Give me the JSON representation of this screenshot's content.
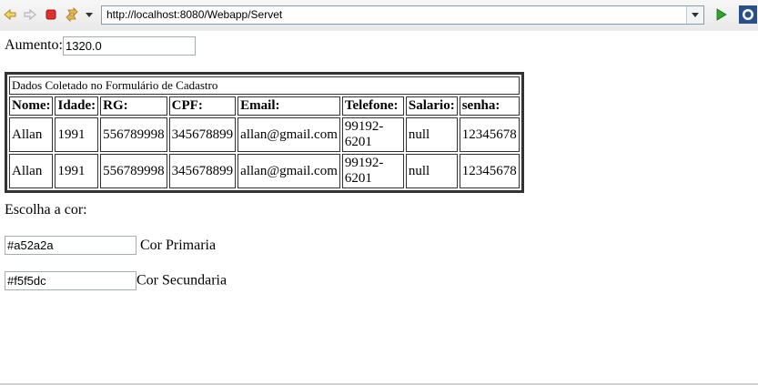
{
  "toolbar": {
    "back_icon": "back-arrow-icon",
    "forward_icon": "forward-arrow-icon",
    "stop_icon": "stop-icon",
    "refresh_icon": "refresh-icon",
    "url": "http://localhost:8080/Webapp/Servet",
    "go_icon": "go-play-icon",
    "eclipse_icon": "browser-app-icon"
  },
  "aumento": {
    "label": "Aumento:",
    "value": "1320.0"
  },
  "table": {
    "caption": "Dados Coletado no Formulário de Cadastro",
    "headers": [
      "Nome:",
      "Idade:",
      "RG:",
      "CPF:",
      "Email:",
      "Telefone:",
      "Salario:",
      "senha:"
    ],
    "rows": [
      [
        "Allan",
        "1991",
        "556789998",
        "345678899",
        "allan@gmail.com",
        "99192-6201",
        "null",
        "12345678"
      ],
      [
        "Allan",
        "1991",
        "556789998",
        "345678899",
        "allan@gmail.com",
        "99192-6201",
        "null",
        "12345678"
      ]
    ]
  },
  "cores": {
    "title": "Escolha a cor:",
    "primaria": {
      "value": "#a52a2a",
      "label": "Cor Primaria"
    },
    "secundaria": {
      "value": "#f5f5dc",
      "label": "Cor Secundaria"
    }
  },
  "colors": {
    "accent_stop": "#e03030",
    "go_green": "#2ea52e",
    "address_border": "#7f9db9"
  }
}
